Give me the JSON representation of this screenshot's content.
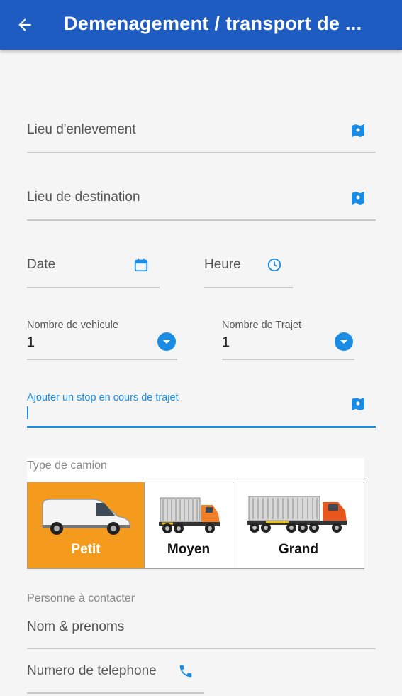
{
  "appbar": {
    "title": "Demenagement / transport de ...",
    "back_icon": "arrow-left-icon"
  },
  "form": {
    "pickup_label": "Lieu d'enlevement",
    "destination_label": "Lieu de destination",
    "date_label": "Date",
    "time_label": "Heure",
    "vehicle_count_label": "Nombre de vehicule",
    "vehicle_count_value": "1",
    "trip_count_label": "Nombre de Trajet",
    "trip_count_value": "1",
    "stop_label": "Ajouter un stop en cours de trajet",
    "truck_type_label": "Type de camion",
    "truck_options": [
      "Petit",
      "Moyen",
      "Grand"
    ],
    "truck_selected": "Petit",
    "contact_label": "Personne à contacter",
    "name_placeholder": "Nom & prenoms",
    "phone_label": "Numero de telephone"
  },
  "colors": {
    "appbar": "#1f5cc2",
    "accent": "#1a8ce4",
    "selected": "#f49b1e"
  }
}
